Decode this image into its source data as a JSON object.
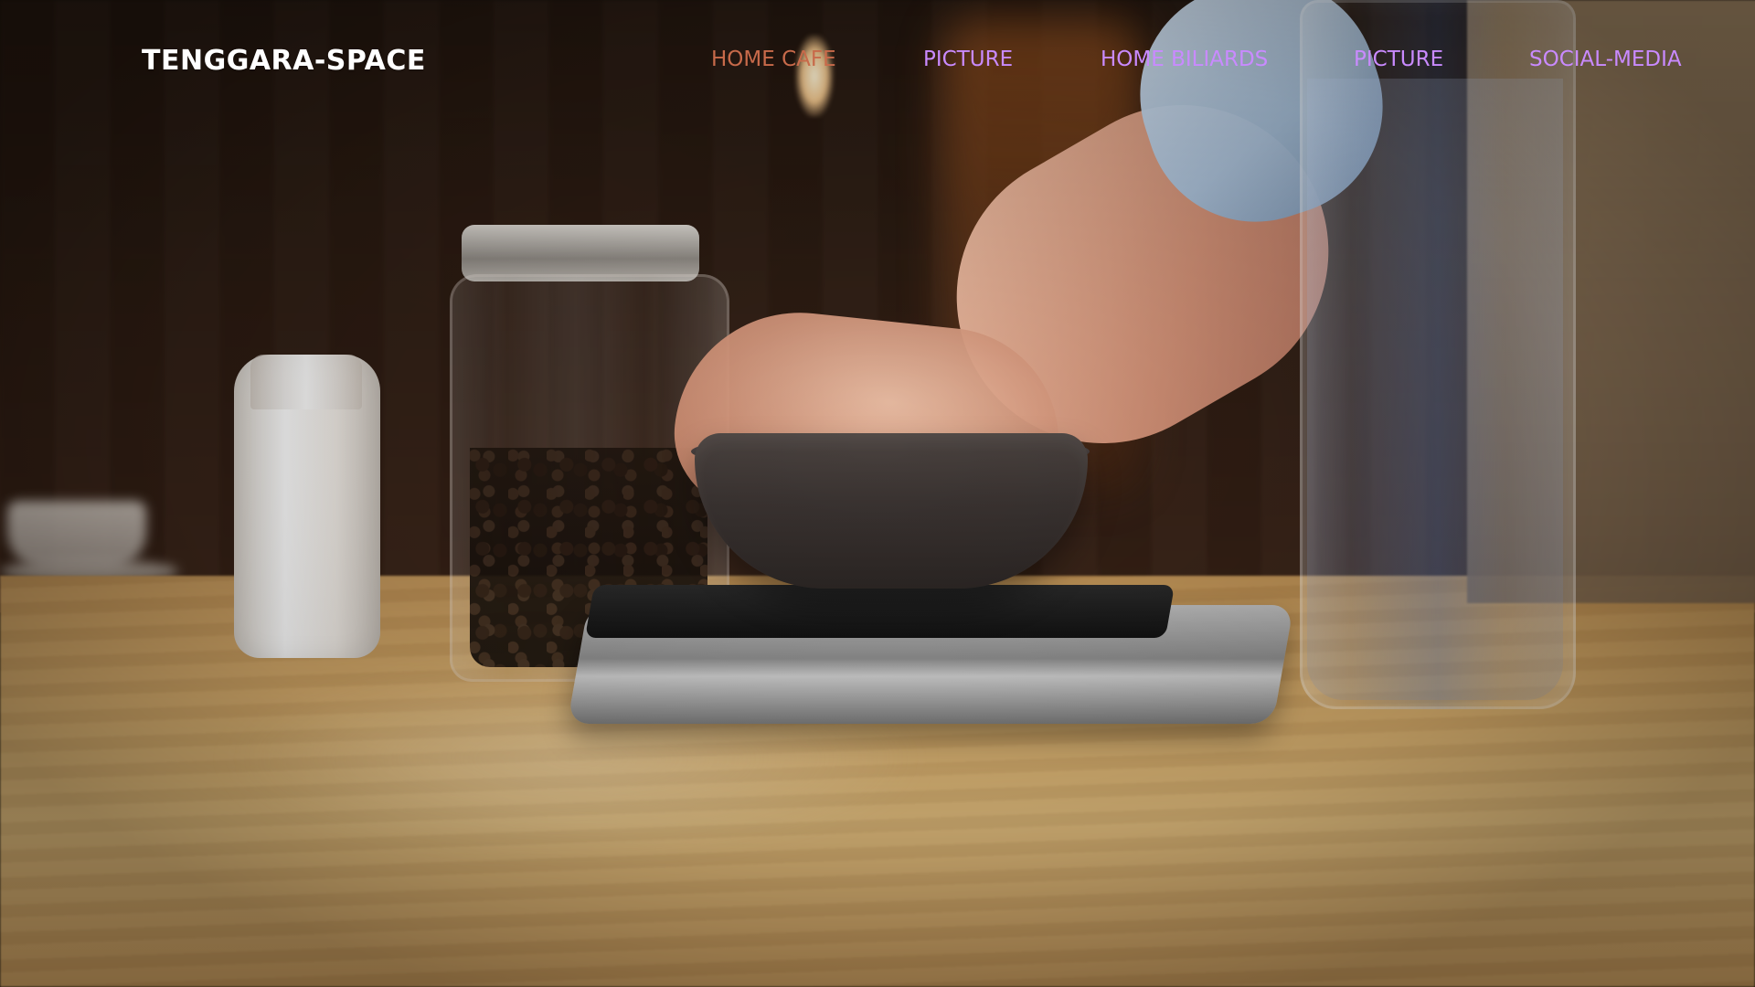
{
  "brand": {
    "name": "TENGGARA-SPACE"
  },
  "nav": {
    "items": [
      {
        "label": "HOME CAFE",
        "active": true
      },
      {
        "label": "PICTURE",
        "active": false
      },
      {
        "label": "HOME BILIARDS",
        "active": false
      },
      {
        "label": "PICTURE",
        "active": false
      },
      {
        "label": "SOCIAL-MEDIA",
        "active": false
      }
    ]
  },
  "hero": {
    "scene": "cafe-counter-coffee-scale-video-background"
  },
  "colors": {
    "nav_link": "#c98aff",
    "nav_active": "#c86a4a",
    "brand": "#ffffff"
  }
}
